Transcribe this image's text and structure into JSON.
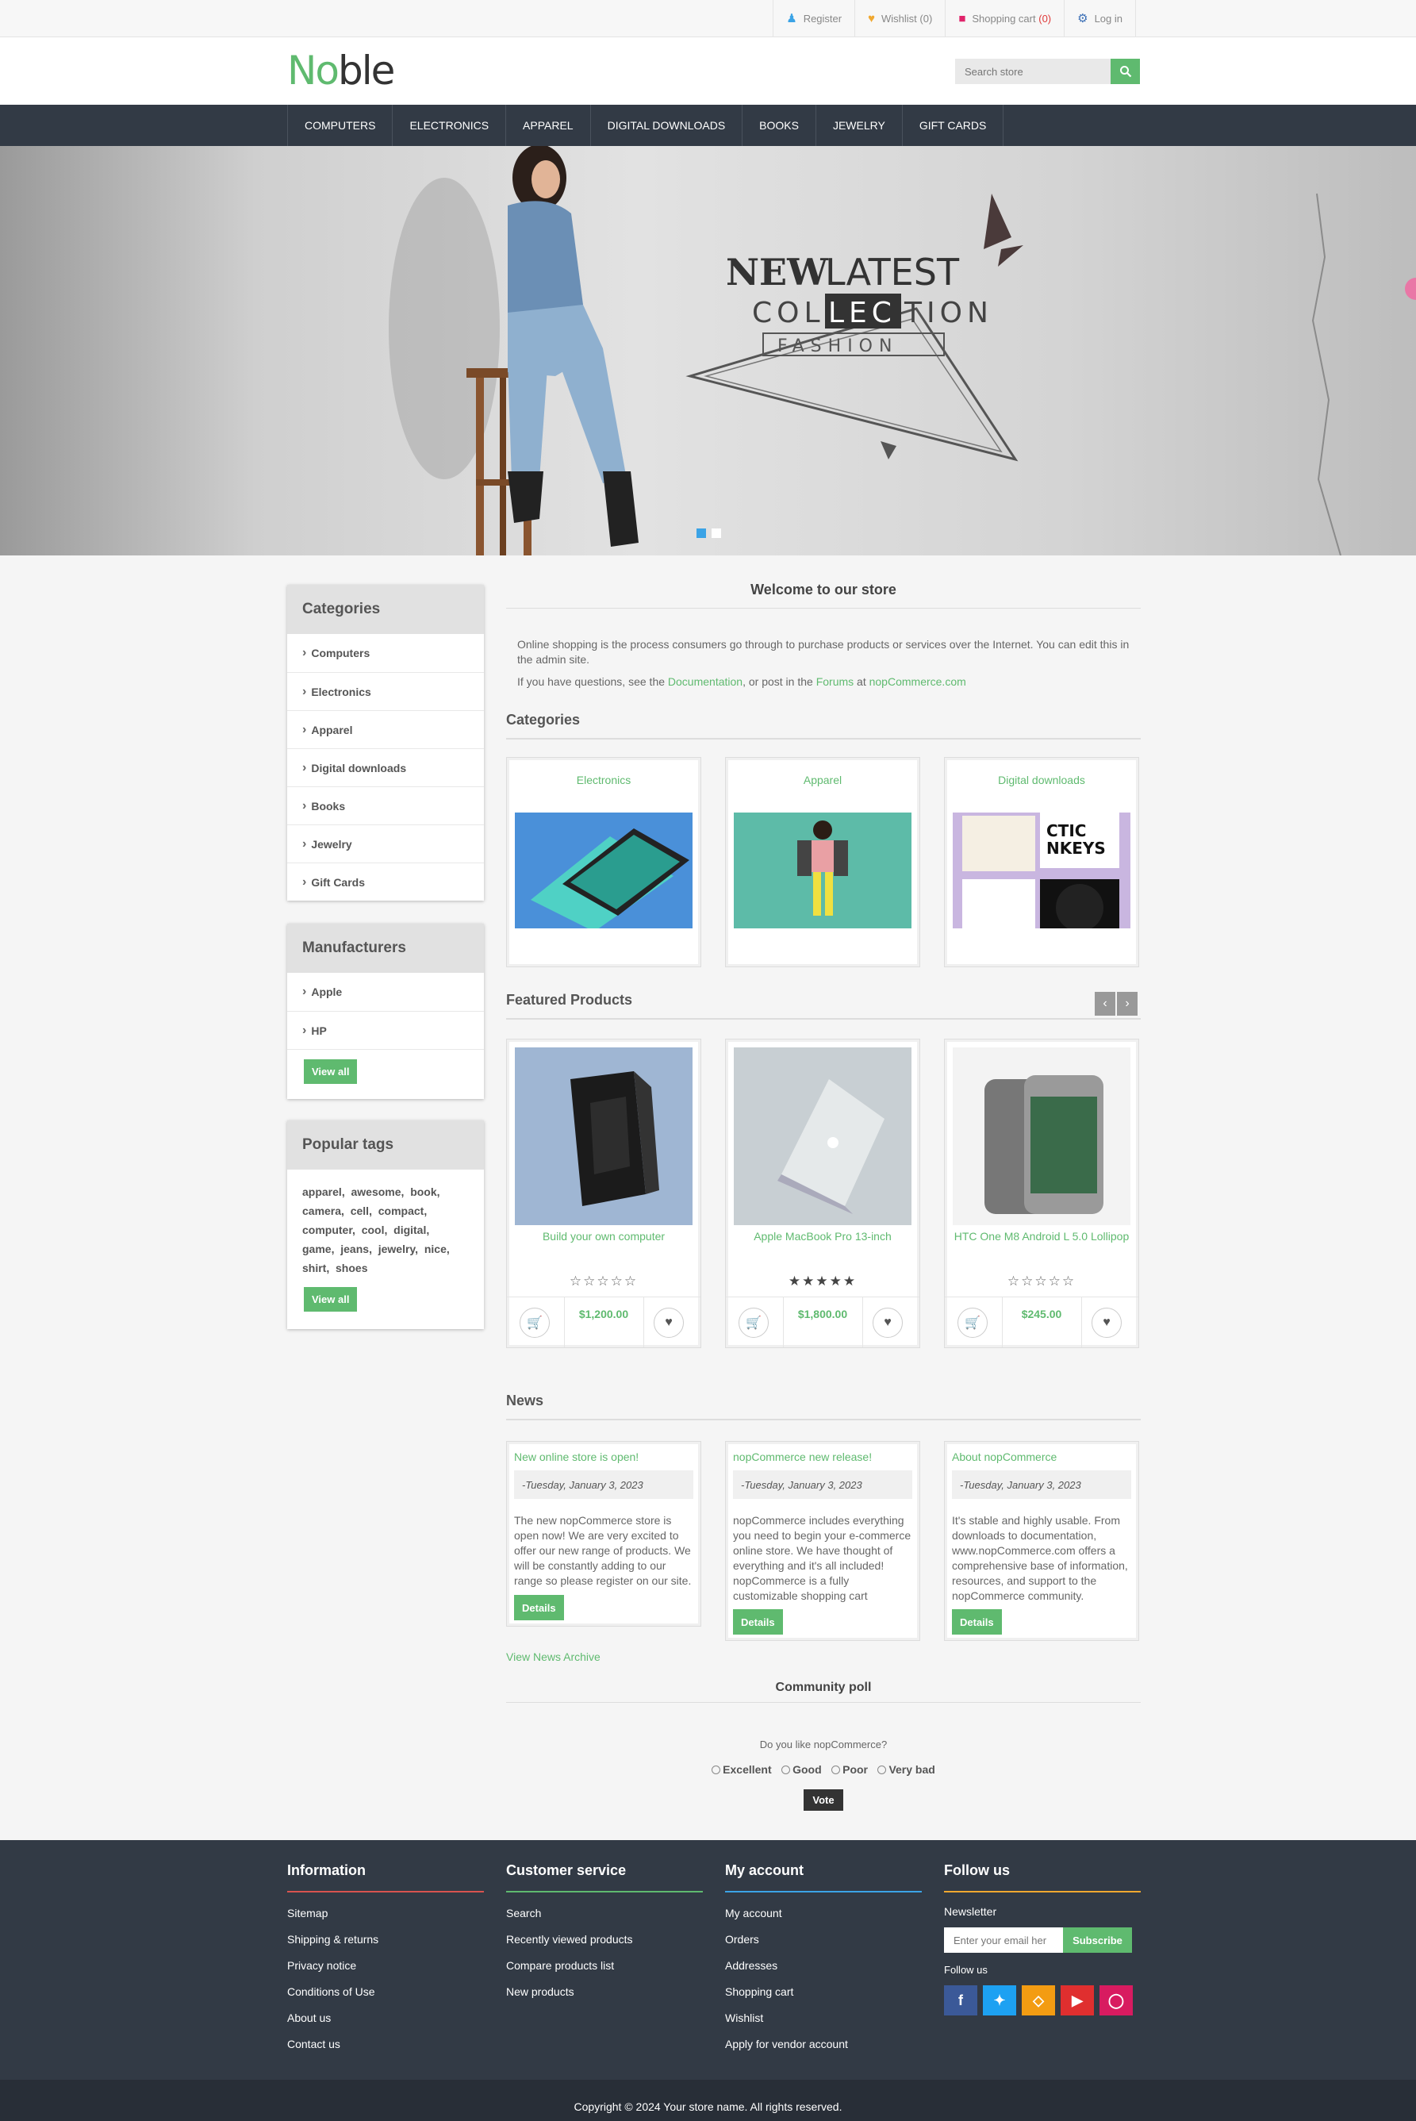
{
  "header_links": {
    "register": "Register",
    "wishlist": "Wishlist",
    "wishlist_count": "(0)",
    "cart": "Shopping cart",
    "cart_count": "(0)",
    "login": "Log in"
  },
  "logo": {
    "part1": "No",
    "part2": "ble"
  },
  "search": {
    "placeholder": "Search store"
  },
  "nav": [
    "COMPUTERS",
    "ELECTRONICS",
    "APPAREL",
    "DIGITAL DOWNLOADS",
    "BOOKS",
    "JEWELRY",
    "GIFT CARDS"
  ],
  "hero": {
    "line1a": "NEW",
    "line1b": "LATEST",
    "line2a": "COL",
    "line2b": "LEC",
    "line2c": "TION",
    "line3": "FASHION",
    "slide_count": 2,
    "active_slide": 1
  },
  "sidebar": {
    "categories_title": "Categories",
    "categories": [
      "Computers",
      "Electronics",
      "Apparel",
      "Digital downloads",
      "Books",
      "Jewelry",
      "Gift Cards"
    ],
    "manufacturers_title": "Manufacturers",
    "manufacturers": [
      "Apple",
      "HP"
    ],
    "view_all": "View all",
    "tags_title": "Popular tags",
    "tags": [
      "apparel",
      "awesome",
      "book",
      "camera",
      "cell",
      "compact",
      "computer",
      "cool",
      "digital",
      "game",
      "jeans",
      "jewelry",
      "nice",
      "shirt",
      "shoes"
    ]
  },
  "main": {
    "welcome": "Welcome to our store",
    "intro": "Online shopping is the process consumers go through to purchase products or services over the Internet. You can edit this in the admin site.",
    "intro2_pre": "If you have questions, see the",
    "intro2_doc": "Documentation",
    "intro2_mid": ", or post in the",
    "intro2_forums": "Forums",
    "intro2_at": "at",
    "intro2_site": "nopCommerce.com",
    "categories_title": "Categories",
    "category_cards": [
      "Electronics",
      "Apparel",
      "Digital downloads"
    ],
    "featured_title": "Featured Products",
    "products": [
      {
        "name": "Build your own computer",
        "price": "$1,200.00",
        "rating": 0
      },
      {
        "name": "Apple MacBook Pro 13-inch",
        "price": "$1,800.00",
        "rating": 5
      },
      {
        "name": "HTC One M8 Android L 5.0 Lollipop",
        "price": "$245.00",
        "rating": 0
      }
    ],
    "news_title": "News",
    "news": [
      {
        "title": "New online store is open!",
        "date": "-Tuesday, January 3, 2023",
        "body": "The new nopCommerce store is open now! We are very excited to offer our new range of products. We will be constantly adding to our range so please register on our site."
      },
      {
        "title": "nopCommerce new release!",
        "date": "-Tuesday, January 3, 2023",
        "body": "nopCommerce includes everything you need to begin your e-commerce online store. We have thought of everything and it's all included! nopCommerce is a fully customizable shopping cart"
      },
      {
        "title": "About nopCommerce",
        "date": "-Tuesday, January 3, 2023",
        "body": "It's stable and highly usable. From downloads to documentation, www.nopCommerce.com offers a comprehensive base of information, resources, and support to the nopCommerce community."
      }
    ],
    "details": "Details",
    "news_archive": "View News Archive",
    "poll_title": "Community poll",
    "poll_question": "Do you like nopCommerce?",
    "poll_options": [
      "Excellent",
      "Good",
      "Poor",
      "Very bad"
    ],
    "vote": "Vote"
  },
  "footer": {
    "information_title": "Information",
    "information": [
      "Sitemap",
      "Shipping & returns",
      "Privacy notice",
      "Conditions of Use",
      "About us",
      "Contact us"
    ],
    "customer_title": "Customer service",
    "customer": [
      "Search",
      "Recently viewed products",
      "Compare products list",
      "New products"
    ],
    "account_title": "My account",
    "account": [
      "My account",
      "Orders",
      "Addresses",
      "Shopping cart",
      "Wishlist",
      "Apply for vendor account"
    ],
    "follow_title": "Follow us",
    "newsletter": "Newsletter",
    "newsletter_placeholder": "Enter your email her",
    "subscribe": "Subscribe",
    "follow_label": "Follow us",
    "copyright": "Copyright © 2024 Your store name. All rights reserved.",
    "colors": {
      "information": "#d9534f",
      "customer": "#5fba6f",
      "account": "#3ba3e6",
      "follow": "#f0a830"
    }
  },
  "colors": {
    "accent": "#5fba6f",
    "nav_bg": "#323a45",
    "footer_bg": "#323a45",
    "slider_active": "#3ba3e6"
  }
}
